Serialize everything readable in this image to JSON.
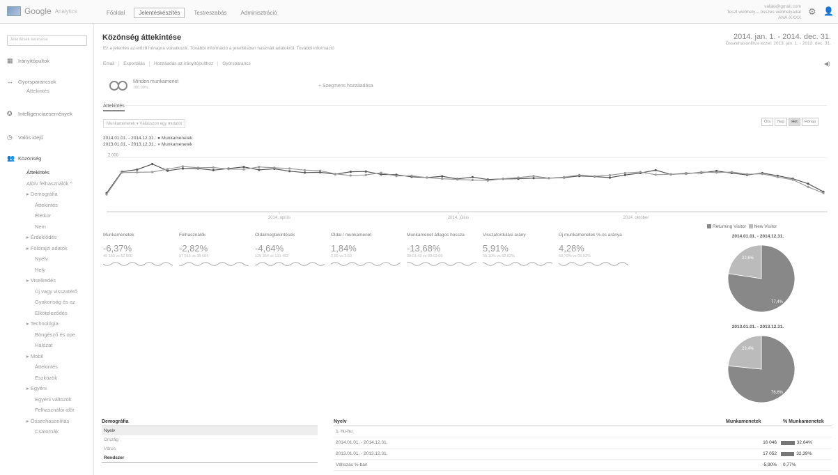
{
  "topbar": {
    "logo_text": "Google",
    "logo_sub": "Analytics",
    "tabs": [
      "Főoldal",
      "Jelentéskészítés",
      "Testreszabás",
      "Adminisztráció"
    ],
    "active_tab": 1,
    "account_line1": "valaki@gmail.com",
    "account_line2": "Teszt webhely – összes webhelyadat",
    "account_line3": "ANA-XXXX"
  },
  "sidebar": {
    "search_placeholder": "Jelentések keresése",
    "items": [
      {
        "icon": "grid-icon",
        "label": "Irányítópultok"
      },
      {
        "icon": "shortcut-icon",
        "label": "Gyorsparancsok",
        "sub": "Áttekintés"
      },
      {
        "icon": "bulb-icon",
        "label": "Intelligenciaesemények"
      },
      {
        "icon": "clock-icon",
        "label": "Valós idejű"
      },
      {
        "icon": "people-icon",
        "label": "Közönség"
      }
    ],
    "audience_subs": [
      {
        "label": "Áttekintés",
        "level": 1,
        "active": true
      },
      {
        "label": "Aktív felhasználók ^",
        "level": 1
      },
      {
        "label": "▸ Demográfia",
        "level": 1
      },
      {
        "label": "Áttekintés",
        "level": 2
      },
      {
        "label": "Életkor",
        "level": 2
      },
      {
        "label": "Nem",
        "level": 2
      },
      {
        "label": "▸ Érdeklődés",
        "level": 1
      },
      {
        "label": "▸ Földrajzi adatok",
        "level": 1
      },
      {
        "label": "Nyelv",
        "level": 2
      },
      {
        "label": "Hely",
        "level": 2
      },
      {
        "label": "▸ Viselkedés",
        "level": 1
      },
      {
        "label": "Új vagy visszatérő",
        "level": 2
      },
      {
        "label": "Gyakoriság és az",
        "level": 2
      },
      {
        "label": "Elköteleződés",
        "level": 2
      },
      {
        "label": "▸ Technológia",
        "level": 1
      },
      {
        "label": "Böngésző és ope",
        "level": 2
      },
      {
        "label": "Hálózat",
        "level": 2
      },
      {
        "label": "▸ Mobil",
        "level": 1
      },
      {
        "label": "Áttekintés",
        "level": 2
      },
      {
        "label": "Eszközök",
        "level": 2
      },
      {
        "label": "▸ Egyéni",
        "level": 1
      },
      {
        "label": "Egyéni változók",
        "level": 2
      },
      {
        "label": "Felhasználói időr",
        "level": 2
      },
      {
        "label": "▸ Összehasonlítás",
        "level": 1
      },
      {
        "label": "Csatornák",
        "level": 2
      }
    ]
  },
  "header": {
    "title": "Közönség áttekintése",
    "description": "Ez a jelentés az előző hónapra vonatkozik. További információ a jelentésben használt adatokról. További információ",
    "date_range": "2014. jan. 1. - 2014. dec. 31.",
    "compare_range": "Összehasonlítva ezzel: 2013. jan. 1. - 2013. dec. 31.",
    "actions": [
      "Email",
      "Exportálás",
      "Hozzáadás az irányítópulthoz",
      "Gyorsparancs"
    ]
  },
  "segment": {
    "label": "Minden munkamenet",
    "sub": "100,00%",
    "add_label": "+ Szegmens hozzáadása"
  },
  "overview_tab": "Áttekintés",
  "chart_controls": {
    "selector": "Munkamenetek  ▾  Válasszon egy mutatót",
    "granularity": [
      "Óra",
      "Nap",
      "Hét",
      "Hónap"
    ],
    "active_granularity": 2
  },
  "chart_data": {
    "type": "line",
    "legend": [
      {
        "range": "2014.01.01. - 2014.12.31.:",
        "name": "Munkamenetek"
      },
      {
        "range": "2013.01.01. - 2013.12.31.:",
        "name": "Munkamenetek"
      }
    ],
    "y_tick": "2 000",
    "x_ticks": [
      "2014. április",
      "2014. július",
      "2014. október"
    ],
    "series": [
      {
        "name": "2014",
        "values": [
          700,
          1500,
          1580,
          1790,
          1540,
          1620,
          1620,
          1560,
          1620,
          1680,
          1570,
          1610,
          1520,
          1470,
          1480,
          1410,
          1500,
          1510,
          1400,
          1390,
          1310,
          1280,
          1330,
          1230,
          1300,
          1210,
          1230,
          1240,
          1260,
          1260,
          1280,
          1340,
          1320,
          1280,
          1380,
          1450,
          1560,
          1400,
          1440,
          1460,
          1530,
          1450,
          1380,
          1450,
          1350,
          1240,
          1050,
          750
        ]
      },
      {
        "name": "2013",
        "values": [
          650,
          1470,
          1480,
          1490,
          1600,
          1700,
          1650,
          1660,
          1600,
          1590,
          1680,
          1650,
          1620,
          1560,
          1540,
          1420,
          1360,
          1380,
          1460,
          1340,
          1350,
          1280,
          1240,
          1210,
          1190,
          1170,
          1240,
          1280,
          1340,
          1260,
          1300,
          1380,
          1330,
          1370,
          1450,
          1490,
          1390,
          1410,
          1420,
          1490,
          1470,
          1490,
          1410,
          1420,
          1300,
          1200,
          930,
          700
        ]
      }
    ],
    "ylim": [
      0,
      2300
    ]
  },
  "metrics": [
    {
      "label": "Munkamenetek",
      "value": "-6,37%",
      "sub": "49 160 vs 52 500"
    },
    {
      "label": "Felhasználók",
      "value": "-2,82%",
      "sub": "37 515 vs 38 604"
    },
    {
      "label": "Oldalmegtekintések",
      "value": "-4,64%",
      "sub": "125 354 vs 131 452"
    },
    {
      "label": "Oldal / munkamenet",
      "value": "1,84%",
      "sub": "2,55 vs 2,50"
    },
    {
      "label": "Munkamenet átlagos hossza",
      "value": "-13,68%",
      "sub": "00:01:43 vs 00:02:00"
    },
    {
      "label": "Visszafordulási arány",
      "value": "5,91%",
      "sub": "55,10% vs 52,02%"
    },
    {
      "label": "Új munkamenetek %-os aránya",
      "value": "4,28%",
      "sub": "69,79% vs 66,93%"
    }
  ],
  "pies": {
    "legend": [
      "Returning Visitor",
      "New Visitor"
    ],
    "colors": [
      "#888888",
      "#bbbbbb"
    ],
    "charts": [
      {
        "title": "2014.01.01. - 2014.12.31.",
        "returning_label": "22,6%",
        "new_label": "77,4%",
        "new_fraction": 0.774
      },
      {
        "title": "2013.01.01. - 2013.12.31.",
        "returning_label": "23,4%",
        "new_label": "76,6%",
        "new_fraction": 0.766
      }
    ]
  },
  "demography": {
    "header": "Demográfia",
    "rows": [
      "Nyelv",
      "Ország",
      "Város"
    ],
    "footer": "Rendszer"
  },
  "detail": {
    "header": "Nyelv",
    "col_sessions": "Munkamenetek",
    "col_pct": "% Munkamenetek",
    "rows": [
      {
        "label": "1. hu-hu",
        "sessions": "",
        "pct": "",
        "bar": 0
      },
      {
        "label": "2014.01.01. - 2014.12.31.",
        "sessions": "16 046",
        "pct": "32,64%",
        "bar": 0.33
      },
      {
        "label": "2013.01.01. - 2013.12.31.",
        "sessions": "17 052",
        "pct": "32,39%",
        "bar": 0.32
      },
      {
        "label": "Változás %-ban",
        "sessions": "-5,90%",
        "pct": "0,77%",
        "bar": 0
      }
    ]
  }
}
